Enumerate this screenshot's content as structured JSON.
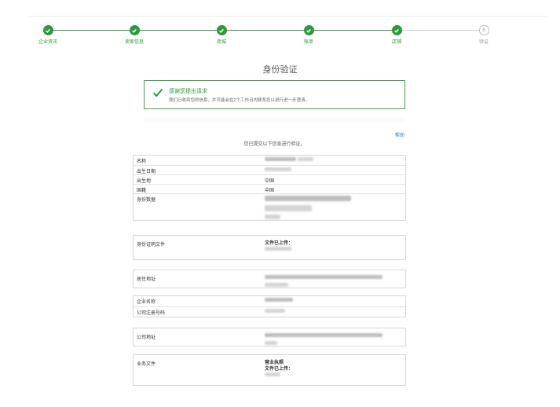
{
  "steps": [
    {
      "label": "企业资讯",
      "done": true
    },
    {
      "label": "卖家信息",
      "done": true
    },
    {
      "label": "商城",
      "done": true
    },
    {
      "label": "账单",
      "done": true
    },
    {
      "label": "店铺",
      "done": true
    },
    {
      "label": "验证",
      "done": false,
      "number": "6"
    }
  ],
  "page_title": "身份验证",
  "notice": {
    "heading": "感谢您提出请求",
    "text": "我们已收到您的信息，并可能会在2个工作日内联系您以进行进一步澄清。"
  },
  "help_link": "帮助",
  "intro": "您已提交以下信息进行验证。",
  "identity": {
    "name": "名称",
    "dob": "出生日期",
    "pob": "出生地",
    "pob_value": "中国",
    "nationality": "国籍",
    "nationality_value": "中国",
    "id_data": "身份数据"
  },
  "id_doc": {
    "label": "身份证明文件",
    "uploaded": "文件已上传："
  },
  "residence": {
    "label": "居住地址"
  },
  "company": {
    "name": "企业名称",
    "reg": "公司注册号码"
  },
  "company_address": {
    "label": "公司地址"
  },
  "business_docs": {
    "label": "业务文件",
    "line1": "营业执照",
    "line2": "文件已上传："
  },
  "colors": {
    "accent": "#2b9a3a",
    "link": "#2a7ab0"
  }
}
